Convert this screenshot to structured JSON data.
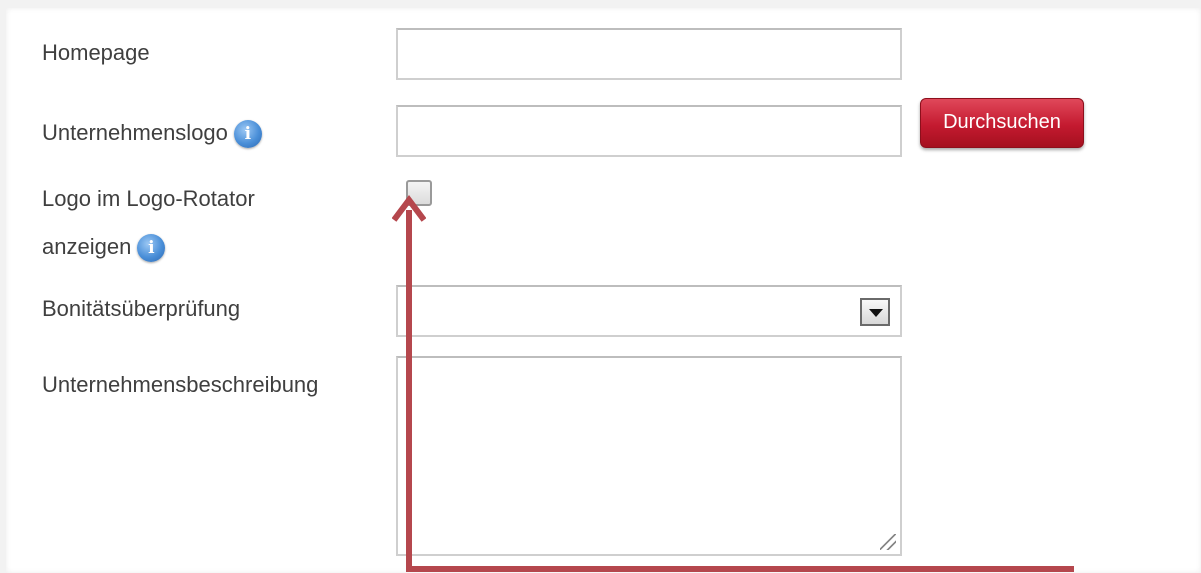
{
  "form": {
    "homepage": {
      "label": "Homepage",
      "value": ""
    },
    "logo": {
      "label": "Unternehmenslogo",
      "value": "",
      "browse_label": "Durchsuchen"
    },
    "rotator": {
      "label_line1": "Logo im Logo-Rotator",
      "label_line2": "anzeigen",
      "checked": false
    },
    "credit_check": {
      "label": "Bonitätsüberprüfung",
      "selected": ""
    },
    "description": {
      "label": "Unternehmensbeschreibung",
      "value": ""
    },
    "info_glyph": "i"
  },
  "colors": {
    "button_red": "#c41a30",
    "annotation_arrow": "#b5474d",
    "info_blue": "#4a8fd8"
  }
}
